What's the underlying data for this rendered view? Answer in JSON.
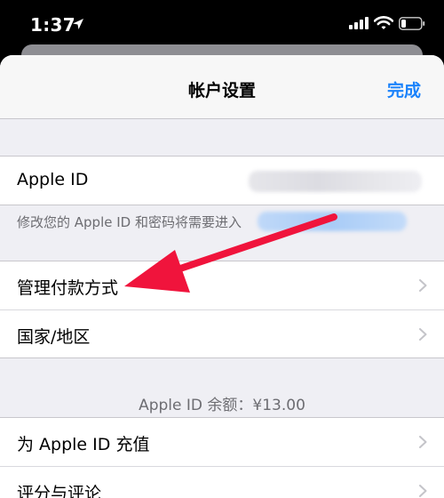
{
  "status": {
    "time": "1:37",
    "icons": [
      "location-arrow-icon",
      "cellular-signal-icon",
      "wifi-icon",
      "battery-icon"
    ]
  },
  "nav": {
    "title": "帐户设置",
    "done": "完成"
  },
  "apple_id_row": {
    "label": "Apple ID"
  },
  "apple_id_note": "修改您的 Apple ID 和密码将需要进入",
  "payment_group": {
    "items": [
      {
        "label": "管理付款方式"
      },
      {
        "label": "国家/地区"
      }
    ]
  },
  "balance": "Apple ID 余额：¥13.00",
  "store_group": {
    "items": [
      {
        "label": "为 Apple ID 充值"
      },
      {
        "label": "评分与评论"
      }
    ]
  },
  "colors": {
    "accent": "#1a82fb",
    "annotation_arrow": "#f0143c"
  }
}
